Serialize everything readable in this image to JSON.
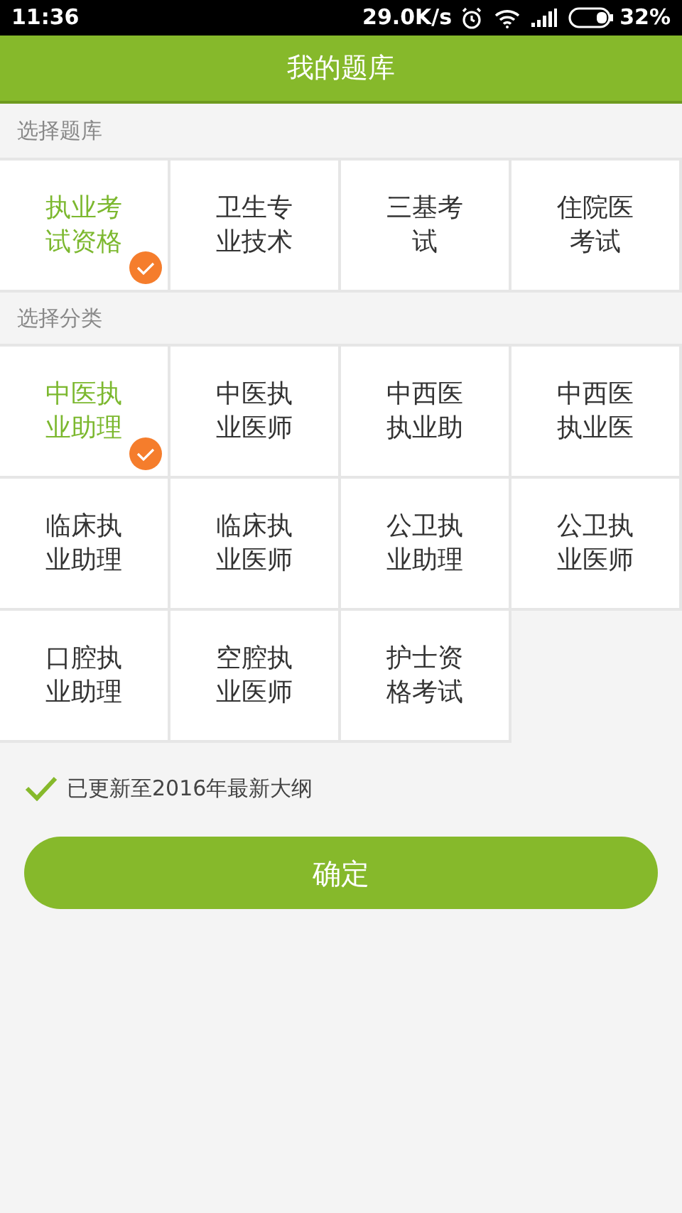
{
  "status_bar": {
    "time": "11:36",
    "speed": "29.0K/s",
    "battery": "32%"
  },
  "header": {
    "title": "我的题库"
  },
  "bank_section": {
    "label": "选择题库",
    "items": [
      {
        "label": "执业考试资格",
        "selected": true
      },
      {
        "label": "卫生专业技术",
        "selected": false
      },
      {
        "label": "三基考试",
        "selected": false
      },
      {
        "label": "住院医考试",
        "selected": false
      }
    ]
  },
  "category_section": {
    "label": "选择分类",
    "items": [
      {
        "label": "中医执业助理",
        "selected": true
      },
      {
        "label": "中医执业医师",
        "selected": false
      },
      {
        "label": "中西医执业助",
        "selected": false
      },
      {
        "label": "中西医执业医",
        "selected": false
      },
      {
        "label": "临床执业助理",
        "selected": false
      },
      {
        "label": "临床执业医师",
        "selected": false
      },
      {
        "label": "公卫执业助理",
        "selected": false
      },
      {
        "label": "公卫执业医师",
        "selected": false
      },
      {
        "label": "口腔执业助理",
        "selected": false
      },
      {
        "label": "空腔执业医师",
        "selected": false
      },
      {
        "label": "护士资格考试",
        "selected": false
      }
    ]
  },
  "update_note": "已更新至2016年最新大纲",
  "confirm_button": "确定"
}
